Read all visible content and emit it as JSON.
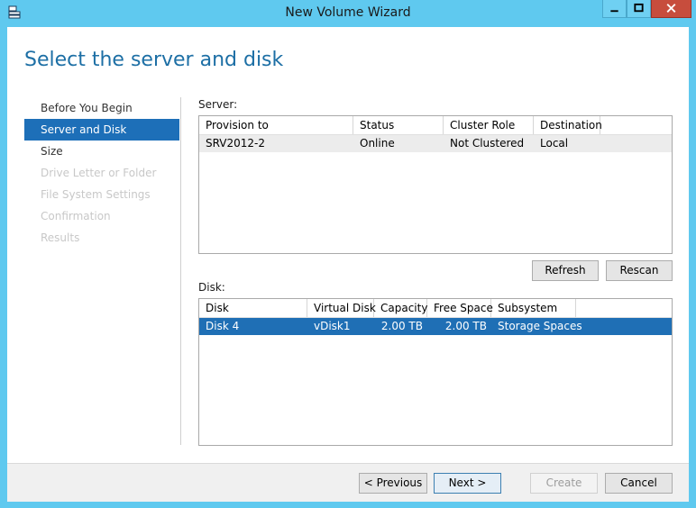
{
  "window": {
    "title": "New Volume Wizard"
  },
  "heading": "Select the server and disk",
  "nav": [
    {
      "label": "Before You Begin",
      "state": "normal"
    },
    {
      "label": "Server and Disk",
      "state": "active"
    },
    {
      "label": "Size",
      "state": "normal"
    },
    {
      "label": "Drive Letter or Folder",
      "state": "disabled"
    },
    {
      "label": "File System Settings",
      "state": "disabled"
    },
    {
      "label": "Confirmation",
      "state": "disabled"
    },
    {
      "label": "Results",
      "state": "disabled"
    }
  ],
  "server": {
    "label": "Server:",
    "columns": [
      "Provision to",
      "Status",
      "Cluster Role",
      "Destination"
    ],
    "rows": [
      [
        "SRV2012-2",
        "Online",
        "Not Clustered",
        "Local"
      ]
    ]
  },
  "buttons_mid": {
    "refresh": "Refresh",
    "rescan": "Rescan"
  },
  "disk": {
    "label": "Disk:",
    "columns": [
      "Disk",
      "Virtual Disk",
      "Capacity",
      "Free Space",
      "Subsystem"
    ],
    "rows": [
      [
        "Disk 4",
        "vDisk1",
        "2.00 TB",
        "2.00 TB",
        "Storage Spaces"
      ]
    ]
  },
  "footer": {
    "previous": "< Previous",
    "next": "Next >",
    "create": "Create",
    "cancel": "Cancel"
  },
  "colors": {
    "accent": "#1d6fb8",
    "frame": "#5fc9ef",
    "close": "#c74d3d"
  }
}
